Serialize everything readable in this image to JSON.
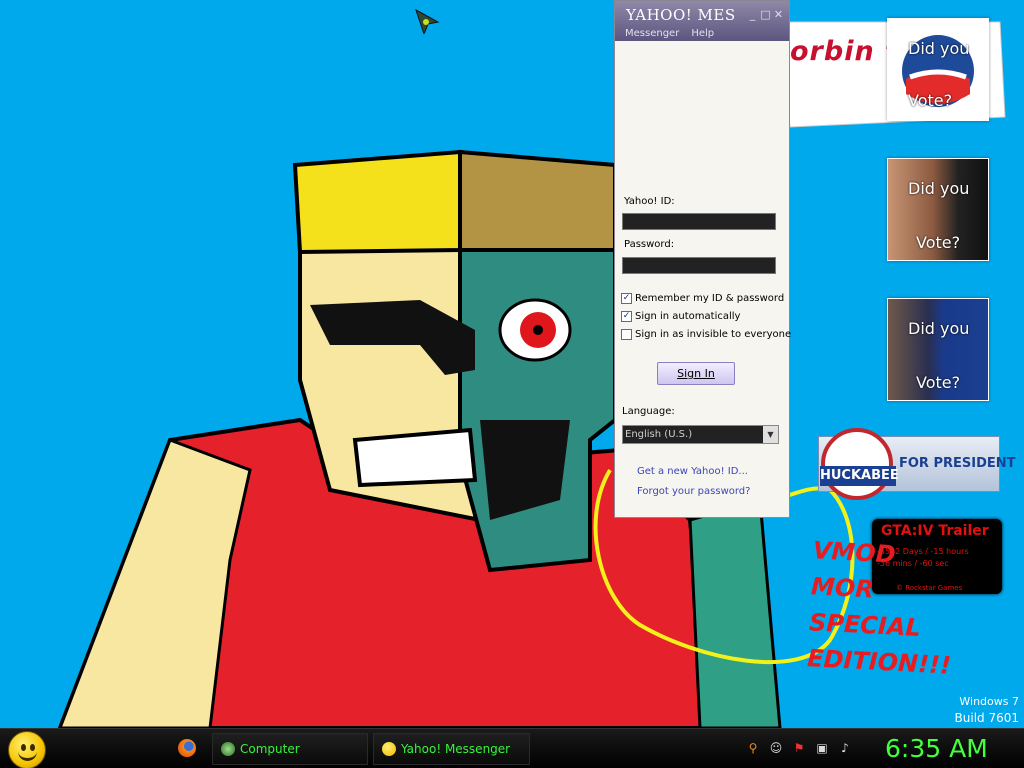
{
  "desktop": {
    "bubble_text": "orbin t",
    "gadgets": {
      "obama": {
        "line1": "Did you",
        "line2": "Vote?"
      },
      "mccain": {
        "line1": "Did you",
        "line2": "Vote?"
      },
      "clinton": {
        "line1": "Did you",
        "line2": "Vote?"
      }
    },
    "huckabee": {
      "name": "HUCKABEE",
      "tagline": "FOR PRESIDENT"
    },
    "gta": {
      "title": "GTA:IV Trailer",
      "line1": "-5542 Days / -15 hours",
      "line2": "-36 mins / -60 sec",
      "credit": "© Rockstar Games"
    },
    "vmod": [
      "VMOD",
      "MOR",
      "SPECIAL",
      "EDITION!!!"
    ],
    "windows_version": {
      "name": "Windows 7",
      "build": "Build 7601"
    }
  },
  "yahoo_messenger": {
    "title": "YAHOO! MES",
    "menu": [
      "Messenger",
      "Help"
    ],
    "yahoo_id_label": "Yahoo! ID:",
    "yahoo_id_value": "",
    "password_label": "Password:",
    "password_value": "",
    "remember_label": "Remember my ID & password",
    "remember_checked": true,
    "auto_label": "Sign in automatically",
    "auto_checked": true,
    "invisible_label": "Sign in as invisible to everyone",
    "invisible_checked": false,
    "signin_label": "Sign In",
    "language_label": "Language:",
    "language_value": "English (U.S.)",
    "link_new_id": "Get a new Yahoo! ID...",
    "link_forgot": "Forgot your password?"
  },
  "taskbar": {
    "buttons": [
      {
        "label": "Computer",
        "icon": "computer-icon"
      },
      {
        "label": "Yahoo! Messenger",
        "icon": "yahoo-messenger-icon"
      }
    ],
    "tray_icons": [
      "search-icon",
      "messenger-icon",
      "action-center-icon",
      "network-icon",
      "volume-icon"
    ],
    "clock": "6:35 AM"
  },
  "colors": {
    "desktop_bg": "#00a8ec",
    "accent_green": "#38f23a",
    "yahoo_purple": "#5c5680"
  }
}
